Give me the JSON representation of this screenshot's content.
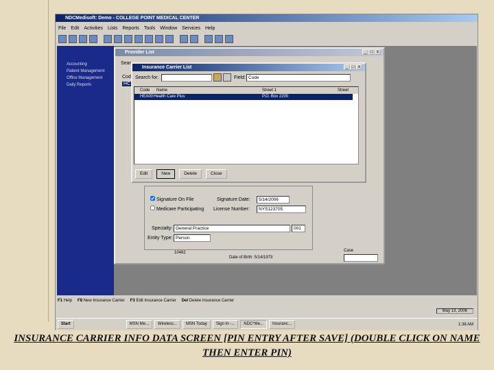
{
  "app": {
    "title": "NDCMedisoft: Demo - COLLEGE POINT MEDICAL CENTER",
    "menu": [
      "File",
      "Edit",
      "Activities",
      "Lists",
      "Reports",
      "Tools",
      "Window",
      "Services",
      "Help"
    ],
    "sidebar": [
      "Accounting",
      "Patient Management",
      "Office Management",
      "Daily Reports"
    ]
  },
  "provider_list": {
    "title": "Provider List",
    "search_label": "Sear",
    "col": "Cod",
    "row": "HC"
  },
  "carrier_list": {
    "title": "Insurance Carrier List",
    "search_label": "Search for:",
    "search_value": "",
    "field_label": "Field:",
    "field_value": "Code",
    "columns": [
      "Code",
      "Name",
      "Street 1",
      "Street"
    ],
    "rows": [
      {
        "code": "HEA00",
        "name": "Health Care Plus",
        "street1": "P.O. Box 2200"
      }
    ],
    "buttons": {
      "edit": "Edit",
      "new": "New",
      "delete": "Delete",
      "close": "Close"
    }
  },
  "details": {
    "signature_on_file": "Signature On File",
    "signature_on_file_checked": true,
    "medicare": "Medicare Participating",
    "medicare_checked": false,
    "signature_date_label": "Signature Date:",
    "signature_date": "5/14/2006",
    "license_label": "License Number:",
    "license": "NYS123705",
    "specialty_label": "Specialty:",
    "specialty": "General Practice",
    "specialty_code": "001",
    "entity_label": "Entity Type:",
    "entity": "Person",
    "id_partial": "10482",
    "dob": "Date of Birth: 5/14/1973",
    "case_label": "Case"
  },
  "fkeys": [
    "Help",
    "New Insurance Carrier",
    "Edit Insurance Carrier",
    "Delete Insurance Carrier"
  ],
  "fkey_caps": [
    "F1",
    "F8",
    "F3",
    "Del"
  ],
  "status_date": "May 13, 2006",
  "taskbar": {
    "start": "Start",
    "items": [
      "MSN Me...",
      "Wireless...",
      "MSN Today",
      "Sign In -...",
      "NDC*Me...",
      "Insuranc..."
    ],
    "time": "1:38 AM"
  },
  "caption": "INSURANCE CARRIER INFO DATA SCREEN [PIN ENTRY AFTER SAVE] (DOUBLE CLICK ON NAME THEN ENTER PIN)"
}
